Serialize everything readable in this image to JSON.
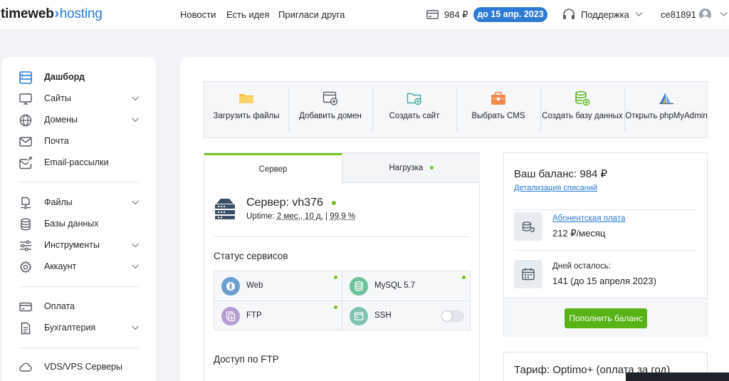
{
  "header": {
    "logo": {
      "part1": "timeweb",
      "arrow": "›",
      "part2": "hosting"
    },
    "nav": [
      "Новости",
      "Есть идея",
      "Пригласи друга"
    ],
    "balance": "984 ₽",
    "due_pill": "до 15 апр. 2023",
    "support": "Поддержка",
    "user": "ce81891"
  },
  "sidebar": {
    "items": [
      {
        "label": "Дашборд",
        "icon": "dashboard-icon"
      },
      {
        "label": "Сайты",
        "icon": "monitor-icon"
      },
      {
        "label": "Домены",
        "icon": "globe-icon"
      },
      {
        "label": "Почта",
        "icon": "mail-icon"
      },
      {
        "label": "Email-рассылки",
        "icon": "mail-send-icon"
      },
      {
        "label": "Файлы",
        "icon": "files-icon"
      },
      {
        "label": "Базы данных",
        "icon": "database-icon"
      },
      {
        "label": "Инструменты",
        "icon": "sliders-icon"
      },
      {
        "label": "Аккаунт",
        "icon": "gear-icon"
      },
      {
        "label": "Оплата",
        "icon": "card-icon"
      },
      {
        "label": "Бухгалтерия",
        "icon": "document-icon"
      },
      {
        "label": "VDS/VPS Серверы",
        "icon": "cloud-icon"
      }
    ]
  },
  "quick_actions": [
    {
      "label": "Загрузить файлы",
      "icon": "folder-icon"
    },
    {
      "label": "Добавить домен",
      "icon": "add-domain-icon"
    },
    {
      "label": "Создать сайт",
      "icon": "add-folder-icon"
    },
    {
      "label": "Выбрать CMS",
      "icon": "cms-case-icon"
    },
    {
      "label": "Создать базу данных",
      "icon": "add-database-icon"
    },
    {
      "label": "Открыть phpMyAdmin",
      "icon": "phpmyadmin-icon"
    }
  ],
  "server": {
    "tabs": [
      "Сервер",
      "Нагрузка"
    ],
    "title": "Сервер: vh376",
    "uptime_label": "Uptime:",
    "uptime_value": "2 мес., 10 д.",
    "uptime_sep": "|",
    "uptime_percent": "99,9 %",
    "status_title": "Статус сервисов",
    "services": [
      {
        "name": "Web",
        "color": "#6b9fd0"
      },
      {
        "name": "MySQL 5.7",
        "color": "#6cc29b"
      },
      {
        "name": "FTP",
        "color": "#b59bd1"
      },
      {
        "name": "SSH",
        "color": "#7fc3b0"
      }
    ],
    "ftp_title": "Доступ по FTP"
  },
  "balance": {
    "title": "Ваш баланс: 984 ₽",
    "details_link": "Детализация списаний",
    "fee_link": "Абонентская плата",
    "fee_value": "212 ₽/месяц",
    "days_caption": "Дней осталось:",
    "days_value": "141 (до 15 апреля 2023)",
    "pay_button": "Пополнить баланс"
  },
  "tariff": {
    "title": "Тариф: Optimo+ (оплата за год)"
  },
  "colors": {
    "accent": "#2c7ad6",
    "green": "#79c221",
    "button": "#57b316"
  }
}
